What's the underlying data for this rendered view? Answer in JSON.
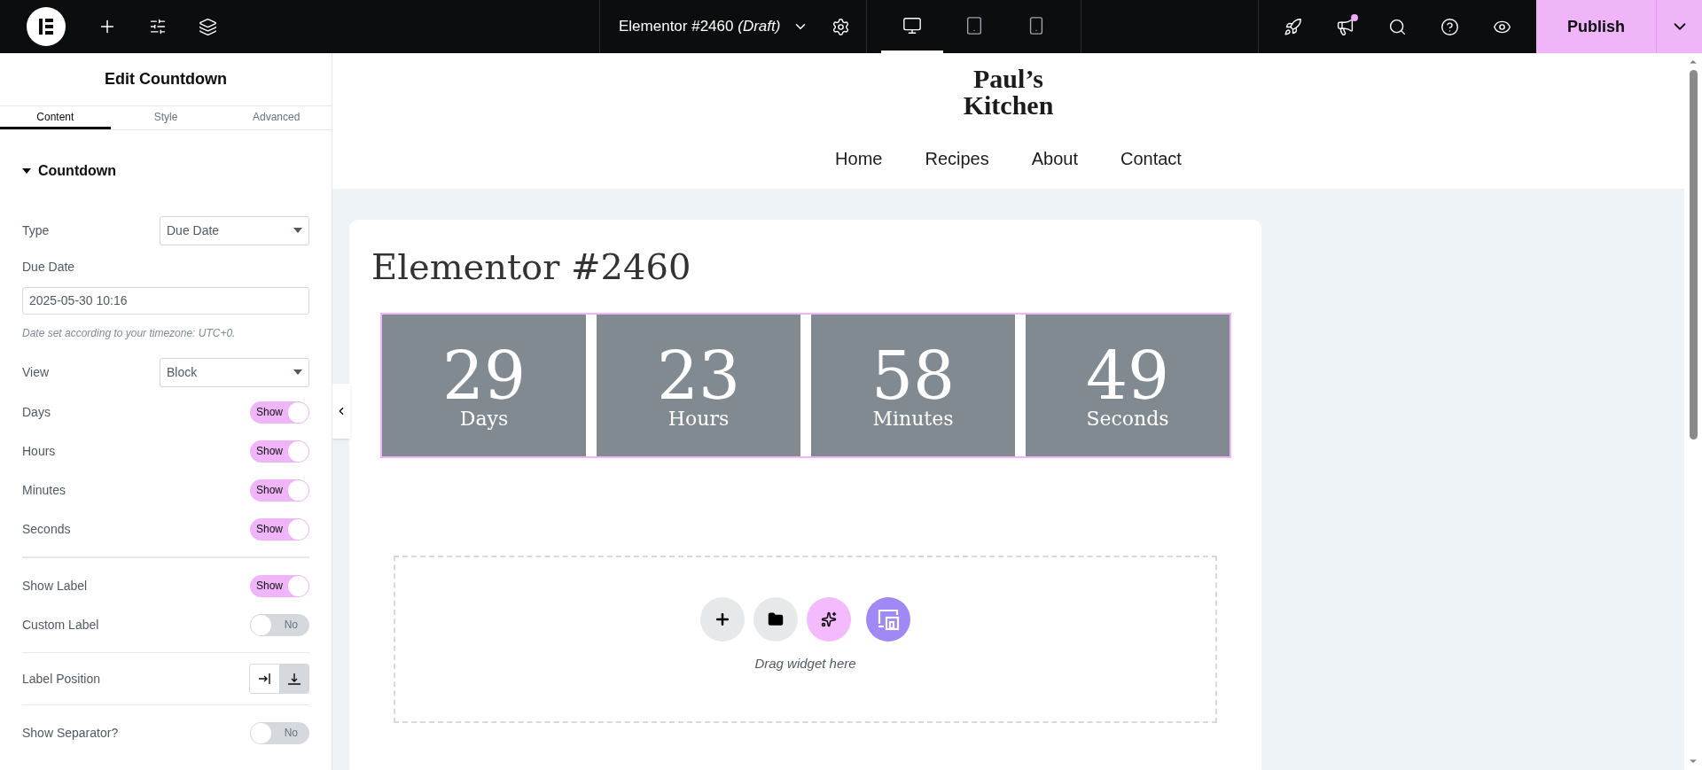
{
  "topbar": {
    "document_title": "Elementor #2460",
    "document_status": "(Draft)",
    "devices": [
      {
        "kind": "desktop",
        "selected": true
      },
      {
        "kind": "tablet",
        "selected": false
      },
      {
        "kind": "mobile",
        "selected": false
      }
    ],
    "notifications_unread": true,
    "publish": "Publish"
  },
  "panel": {
    "title": "Edit Countdown",
    "tabs": [
      {
        "label": "Content",
        "selected": true
      },
      {
        "label": "Style",
        "selected": false
      },
      {
        "label": "Advanced",
        "selected": false
      }
    ],
    "section": {
      "title": "Countdown",
      "expanded": true
    },
    "groups": [
      [
        {
          "kind": "select",
          "label": "Type",
          "value": "Due Date"
        },
        {
          "kind": "date",
          "label": "Due Date",
          "value": "2025-05-30 10:16"
        },
        {
          "kind": "note",
          "text": "Date set according to your timezone: UTC+0."
        },
        {
          "kind": "select",
          "label": "View",
          "value": "Block"
        },
        {
          "kind": "switch",
          "label": "Days",
          "on": true,
          "text": "Show"
        },
        {
          "kind": "switch",
          "label": "Hours",
          "on": true,
          "text": "Show"
        },
        {
          "kind": "switch",
          "label": "Minutes",
          "on": true,
          "text": "Show"
        },
        {
          "kind": "switch",
          "label": "Seconds",
          "on": true,
          "text": "Show"
        }
      ],
      [
        {
          "kind": "switch",
          "label": "Show Label",
          "on": true,
          "text": "Show"
        },
        {
          "kind": "switch",
          "label": "Custom Label",
          "on": false,
          "text": "No"
        }
      ],
      [
        {
          "kind": "choices",
          "label": "Label Position",
          "options": [
            {
              "kind": "inline",
              "selected": false
            },
            {
              "kind": "block",
              "selected": true
            }
          ]
        }
      ],
      [
        {
          "kind": "switch",
          "label": "Show Separator?",
          "on": false,
          "text": "No"
        }
      ]
    ]
  },
  "site": {
    "logo": [
      "Paul’s",
      "Kitchen"
    ],
    "nav": [
      "Home",
      "Recipes",
      "About",
      "Contact"
    ]
  },
  "page_title": "Elementor #2460",
  "countdown": [
    {
      "value": "29",
      "label": "Days"
    },
    {
      "value": "23",
      "label": "Hours"
    },
    {
      "value": "58",
      "label": "Minutes"
    },
    {
      "value": "49",
      "label": "Seconds"
    }
  ],
  "dropzone": {
    "hint": "Drag widget here"
  }
}
